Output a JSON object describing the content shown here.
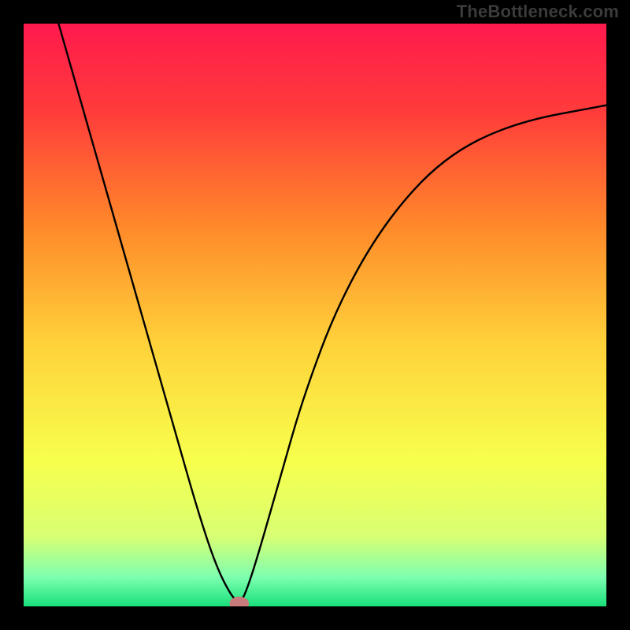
{
  "watermark": "TheBottleneck.com",
  "chart_data": {
    "type": "line",
    "title": "",
    "xlabel": "",
    "ylabel": "",
    "xlim": [
      0,
      100
    ],
    "ylim": [
      0,
      100
    ],
    "background_gradient": {
      "stops": [
        {
          "offset": 0.0,
          "color": "#ff1a4d"
        },
        {
          "offset": 0.15,
          "color": "#ff3b3b"
        },
        {
          "offset": 0.35,
          "color": "#ff8a2a"
        },
        {
          "offset": 0.55,
          "color": "#ffd23a"
        },
        {
          "offset": 0.75,
          "color": "#f7ff4d"
        },
        {
          "offset": 0.88,
          "color": "#d8ff73"
        },
        {
          "offset": 0.95,
          "color": "#7dffb0"
        },
        {
          "offset": 1.0,
          "color": "#18e07a"
        }
      ]
    },
    "series": [
      {
        "name": "bottleneck-curve",
        "x": [
          6,
          10,
          14,
          18,
          22,
          26,
          30,
          33,
          35.5,
          37,
          38,
          40,
          44,
          48,
          54,
          62,
          72,
          84,
          100
        ],
        "y": [
          100,
          86,
          72,
          58,
          44,
          30,
          16,
          7,
          2,
          0.5,
          2,
          8,
          22,
          36,
          52,
          66,
          77,
          83,
          86
        ]
      }
    ],
    "marker": {
      "x": 37,
      "y": 0.5,
      "rx": 1.6,
      "ry": 1.1,
      "color": "#c97a7a"
    }
  }
}
